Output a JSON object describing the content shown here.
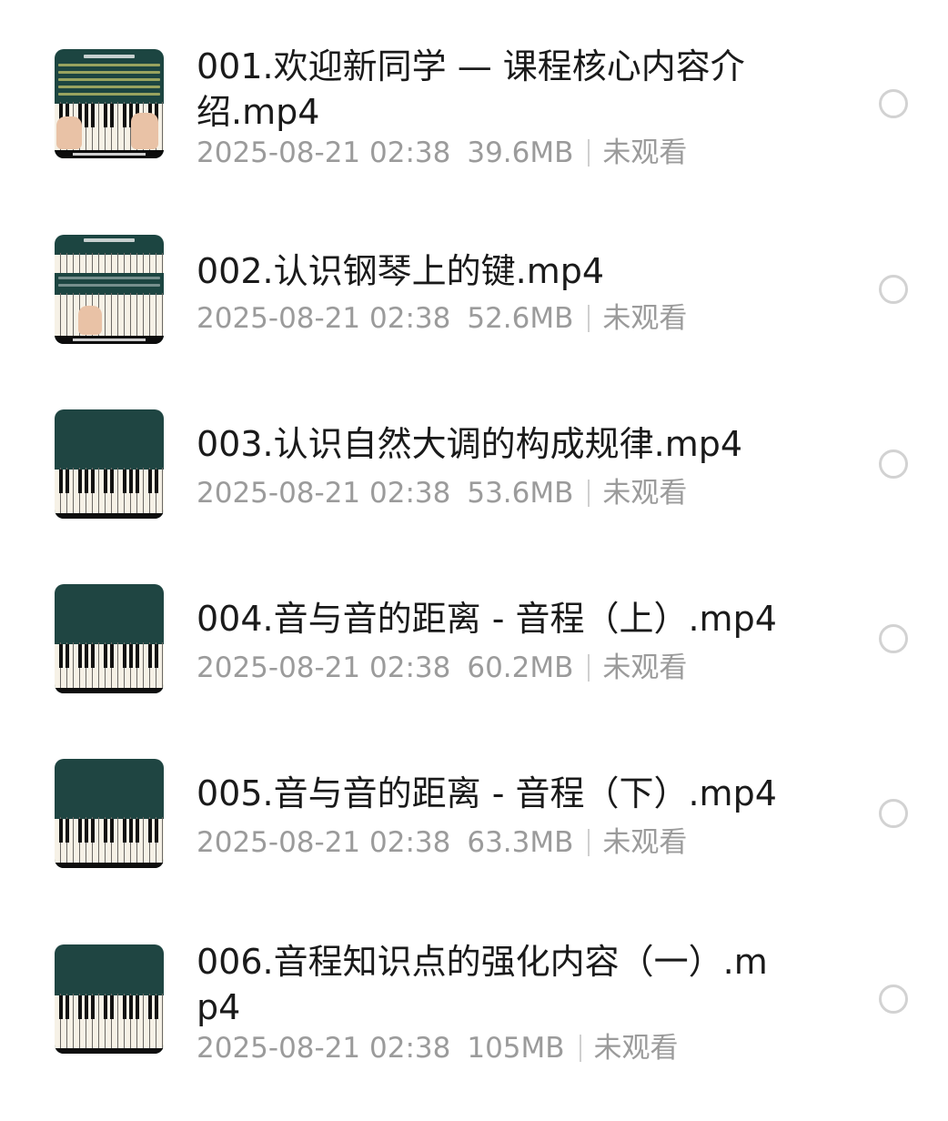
{
  "items": [
    {
      "title": "001.欢迎新同学 — 课程核心内容介绍.mp4",
      "date": "2025-08-21 02:38",
      "size": "39.6MB",
      "status": "未观看"
    },
    {
      "title": "002.认识钢琴上的键.mp4",
      "date": "2025-08-21 02:38",
      "size": "52.6MB",
      "status": "未观看"
    },
    {
      "title": "003.认识自然大调的构成规律.mp4",
      "date": "2025-08-21 02:38",
      "size": "53.6MB",
      "status": "未观看"
    },
    {
      "title": "004.音与音的距离 - 音程（上）.mp4",
      "date": "2025-08-21 02:38",
      "size": "60.2MB",
      "status": "未观看"
    },
    {
      "title": "005.音与音的距离 - 音程（下）.mp4",
      "date": "2025-08-21 02:38",
      "size": "63.3MB",
      "status": "未观看"
    },
    {
      "title": "006.音程知识点的强化内容（一）.mp4",
      "date": "2025-08-21 02:38",
      "size": "105MB",
      "status": "未观看"
    }
  ],
  "colors": {
    "thumb_bg": "#1f4542",
    "meta_text": "#9b9b9b",
    "title_text": "#1a1a1a",
    "radio_border": "#d2d2d2"
  },
  "icons": {
    "thumbnail": "piano-video-thumbnail",
    "select": "radio-unchecked-icon"
  }
}
